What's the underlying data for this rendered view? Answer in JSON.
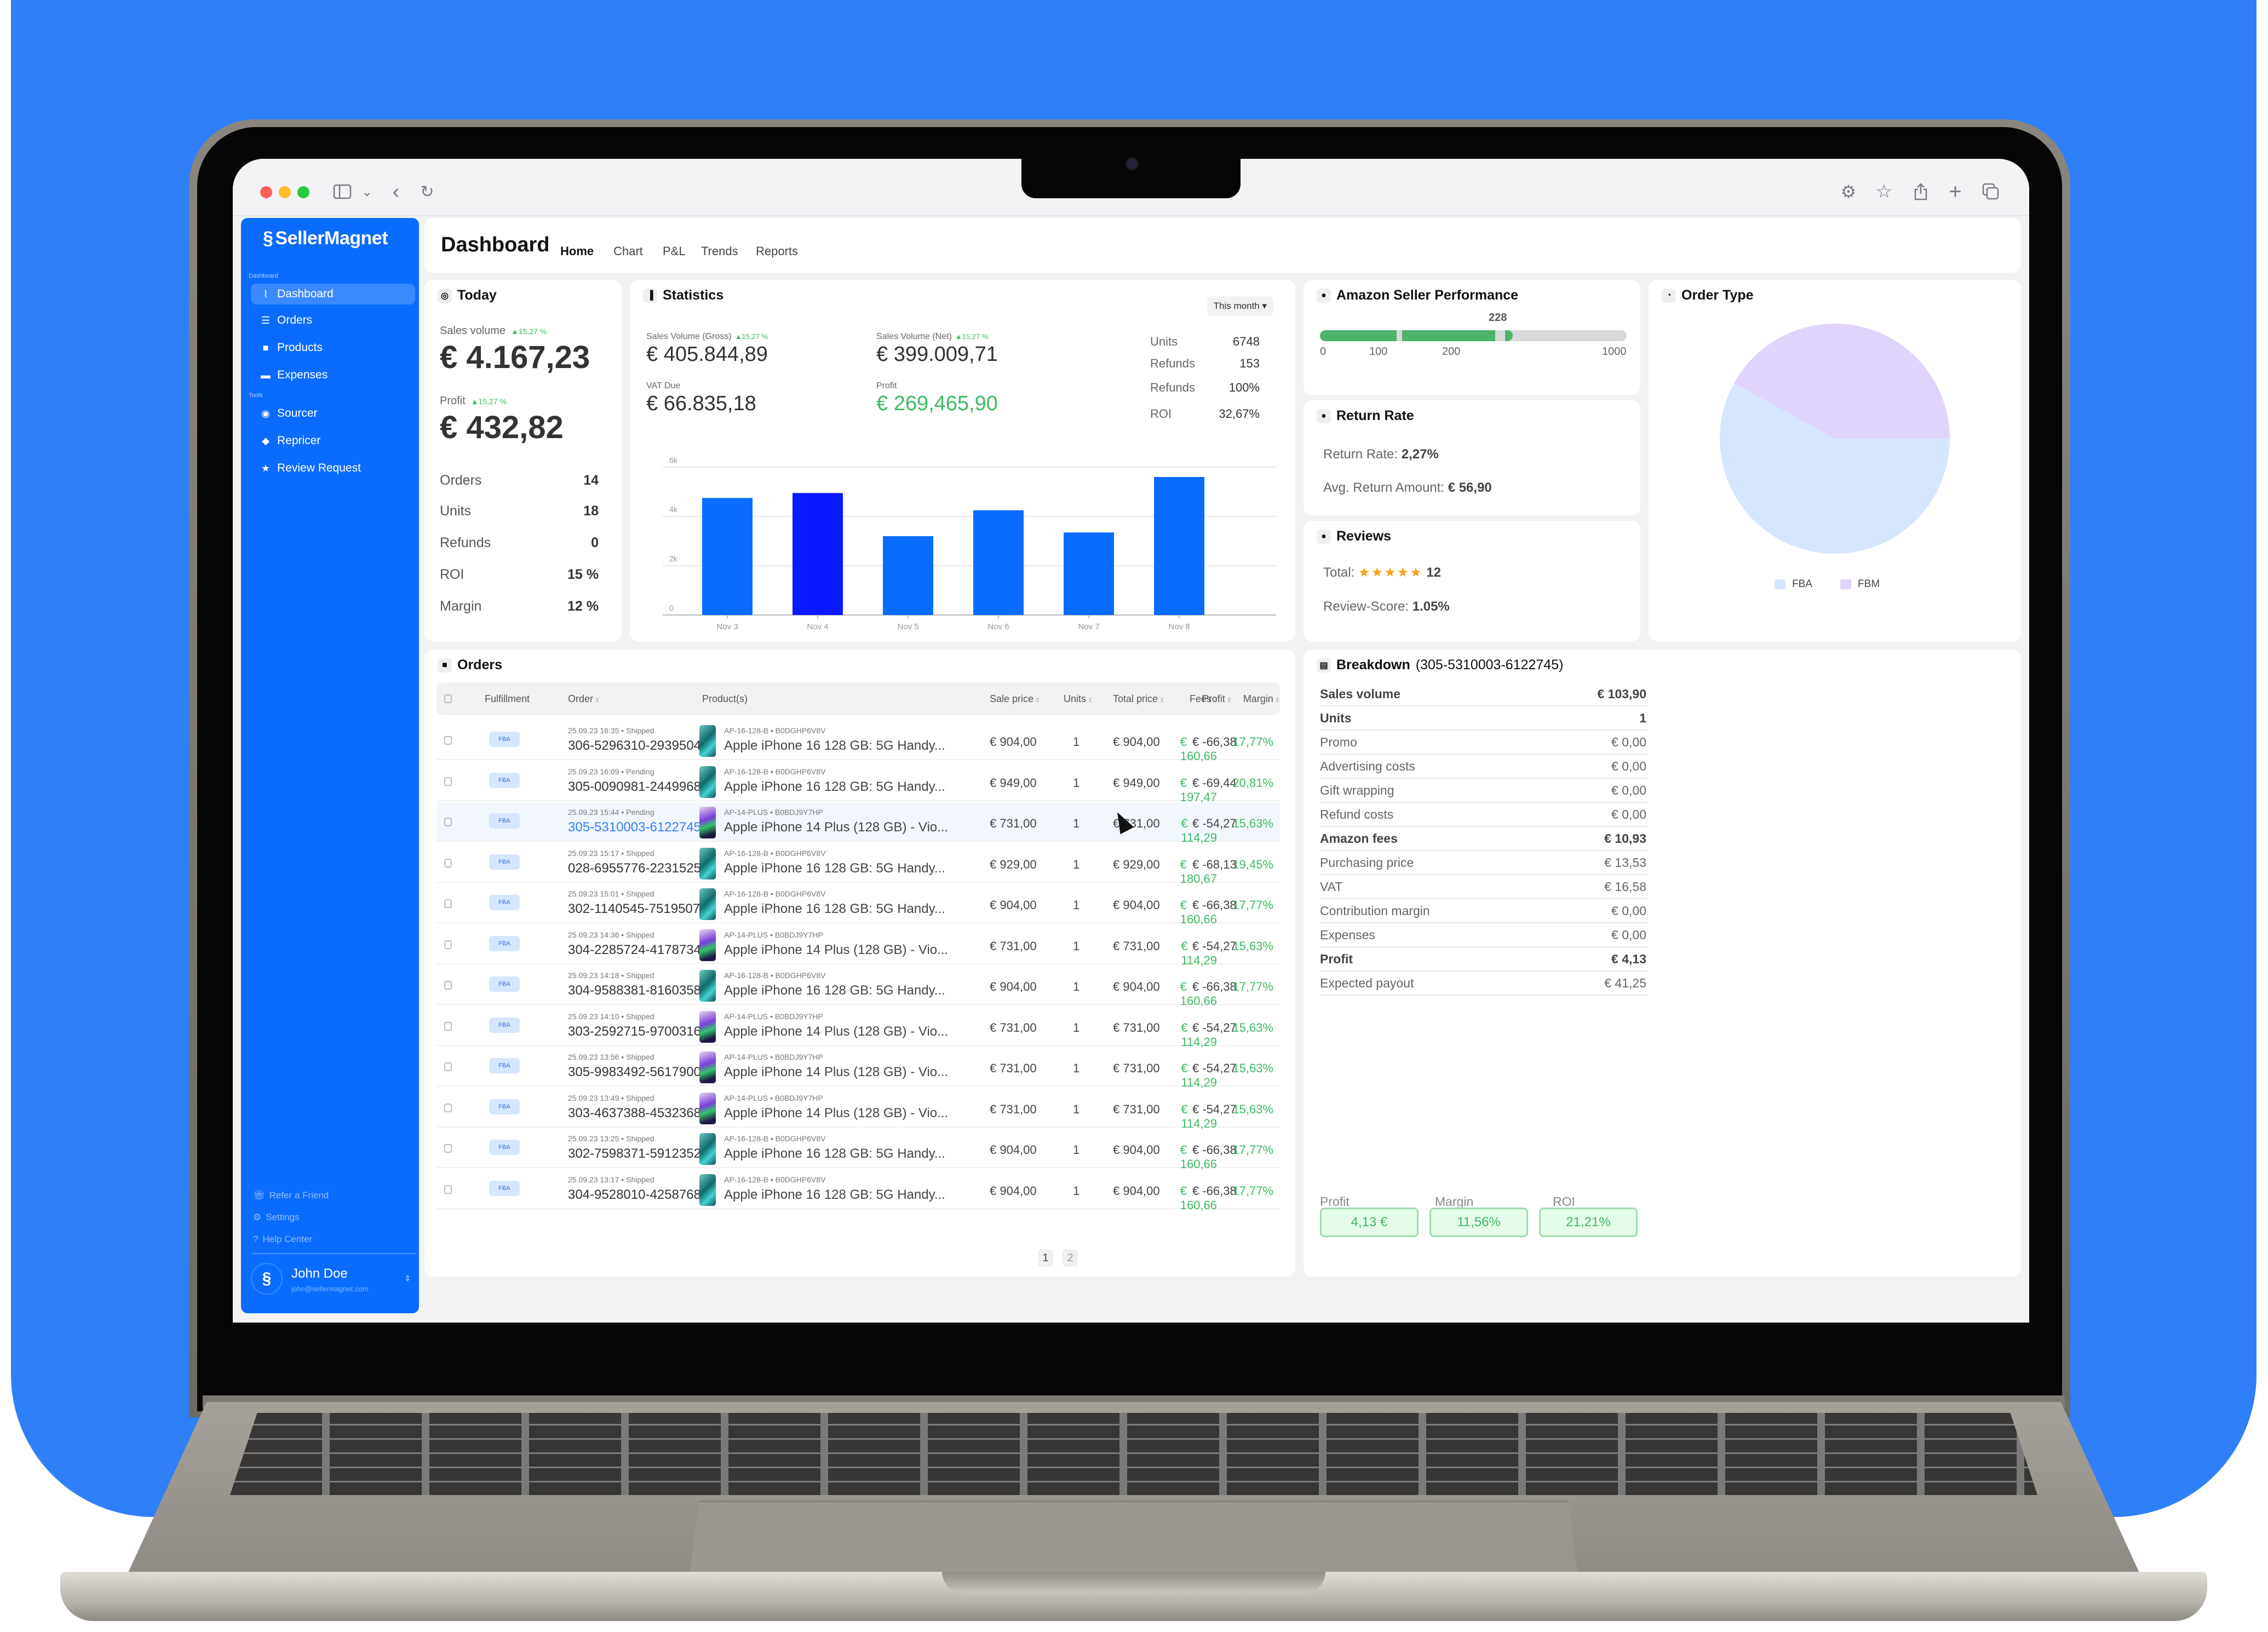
{
  "browser": {
    "toolbar_icons_left": [
      "sidebar-toggle-icon",
      "chevron-down-icon",
      "back-icon",
      "reload-icon"
    ],
    "toolbar_icons_right": [
      "gear-icon",
      "star-icon",
      "share-icon",
      "plus-icon",
      "tabs-icon"
    ]
  },
  "sidebar": {
    "logo": "SellerMagnet",
    "section_dashboard": "Dashboard",
    "section_tools": "Tools",
    "items": [
      {
        "label": "Dashboard",
        "icon": "chart-line-icon",
        "active": true
      },
      {
        "label": "Orders",
        "icon": "list-icon"
      },
      {
        "label": "Products",
        "icon": "box-icon"
      },
      {
        "label": "Expenses",
        "icon": "credit-card-icon"
      },
      {
        "label": "Sourcer",
        "icon": "radar-icon"
      },
      {
        "label": "Repricer",
        "icon": "tag-icon"
      },
      {
        "label": "Review Request",
        "icon": "star-icon"
      }
    ],
    "footer": [
      {
        "label": "Refer a Friend",
        "icon": "gift-icon"
      },
      {
        "label": "Settings",
        "icon": "gear-icon"
      },
      {
        "label": "Help Center",
        "icon": "help-icon"
      }
    ],
    "user": {
      "name": "John Doe",
      "email": "john@sellermagnet.com"
    }
  },
  "header": {
    "title": "Dashboard",
    "tabs": [
      "Home",
      "Chart",
      "P&L",
      "Trends",
      "Reports"
    ],
    "active_tab": "Home"
  },
  "today": {
    "title": "Today",
    "sales_label": "Sales volume",
    "sales_change": "▲15,27 %",
    "sales_value": "€ 4.167,23",
    "profit_label": "Profit",
    "profit_change": "▲15,27 %",
    "profit_value": "€ 432,82",
    "rows": [
      {
        "label": "Orders",
        "value": "14"
      },
      {
        "label": "Units",
        "value": "18"
      },
      {
        "label": "Refunds",
        "value": "0"
      },
      {
        "label": "ROI",
        "value": "15 %"
      },
      {
        "label": "Margin",
        "value": "12 %"
      }
    ]
  },
  "statistics": {
    "title": "Statistics",
    "period": "This month ▾",
    "gross_label": "Sales Volume (Gross)",
    "gross_change": "▲15,27 %",
    "gross_value": "€ 405.844,89",
    "net_label": "Sales Volume (Net)",
    "net_change": "▲15,27 %",
    "net_value": "€ 399.009,71",
    "vat_label": "VAT Due",
    "vat_value": "€ 66.835,18",
    "profit_label": "Profit",
    "profit_value": "€ 269,465,90",
    "side": [
      {
        "label": "Units",
        "value": "6748"
      },
      {
        "label": "Refunds",
        "value": "153"
      },
      {
        "label": "Refunds",
        "value": "100%"
      },
      {
        "label": "ROI",
        "value": "32,67%"
      }
    ]
  },
  "seller_performance": {
    "title": "Amazon Seller Performance",
    "value": 228,
    "value_label": "228",
    "max": 1000,
    "ticks": [
      "0",
      "100",
      "200",
      "1000"
    ],
    "color": "#4db36a"
  },
  "return_rate": {
    "title": "Return Rate",
    "rate_label": "Return Rate:",
    "rate_value": "2,27%",
    "avg_label": "Avg. Return Amount:",
    "avg_value": "€ 56,90"
  },
  "reviews": {
    "title": "Reviews",
    "total_label": "Total:",
    "stars": "★★★★★",
    "total_value": "12",
    "score_label": "Review-Score:",
    "score_value": "1.05%"
  },
  "order_type": {
    "title": "Order Type"
  },
  "orders": {
    "title": "Orders",
    "columns": [
      "Fulfillment",
      "Order",
      "Product(s)",
      "Sale price",
      "Units",
      "Total price",
      "Fees",
      "Profit",
      "Margin"
    ],
    "rows": [
      {
        "fulfillment": "FBA",
        "meta": "25.09.23 16:35 • Shipped",
        "order": "306-5296310-2939504",
        "sku": "AP-16-128-B • B0DGHP6V8V",
        "product": "Apple iPhone 16 128 GB: 5G Handy...",
        "thumb": "g",
        "sale": "€ 904,00",
        "units": "1",
        "total": "€ 904,00",
        "fees": "€ -66,38",
        "profit": "€ 160,66",
        "margin": "17,77%"
      },
      {
        "fulfillment": "FBA",
        "meta": "25.09.23 16:09 • Pending",
        "order": "305-0090981-2449968",
        "sku": "AP-16-128-B • B0DGHP6V8V",
        "product": "Apple iPhone 16 128 GB: 5G Handy...",
        "thumb": "g",
        "sale": "€ 949,00",
        "units": "1",
        "total": "€ 949,00",
        "fees": "€ -69,44",
        "profit": "€ 197,47",
        "margin": "20,81%"
      },
      {
        "fulfillment": "FBA",
        "meta": "25.09.23 15:44 • Pending",
        "order": "305-5310003-6122745",
        "sku": "AP-14-PLUS • B0BDJ9Y7HP",
        "product": "Apple iPhone 14 Plus (128 GB) - Vio...",
        "thumb": "p",
        "sale": "€ 731,00",
        "units": "1",
        "total": "€ 731,00",
        "fees": "€ -54,27",
        "profit": "€ 114,29",
        "margin": "15,63%",
        "selected": true
      },
      {
        "fulfillment": "FBA",
        "meta": "25.09.23 15:17 • Shipped",
        "order": "028-6955776-2231525",
        "sku": "AP-16-128-B • B0DGHP6V8V",
        "product": "Apple iPhone 16 128 GB: 5G Handy...",
        "thumb": "g",
        "sale": "€ 929,00",
        "units": "1",
        "total": "€ 929,00",
        "fees": "€ -68,13",
        "profit": "€ 180,67",
        "margin": "19,45%"
      },
      {
        "fulfillment": "FBA",
        "meta": "25.09.23 15:01 • Shipped",
        "order": "302-1140545-7519507",
        "sku": "AP-16-128-B • B0DGHP6V8V",
        "product": "Apple iPhone 16 128 GB: 5G Handy...",
        "thumb": "g",
        "sale": "€ 904,00",
        "units": "1",
        "total": "€ 904,00",
        "fees": "€ -66,38",
        "profit": "€ 160,66",
        "margin": "17,77%"
      },
      {
        "fulfillment": "FBA",
        "meta": "25.09.23 14:36 • Shipped",
        "order": "304-2285724-4178734",
        "sku": "AP-14-PLUS • B0BDJ9Y7HP",
        "product": "Apple iPhone 14 Plus (128 GB) - Vio...",
        "thumb": "p",
        "sale": "€ 731,00",
        "units": "1",
        "total": "€ 731,00",
        "fees": "€ -54,27",
        "profit": "€ 114,29",
        "margin": "15,63%"
      },
      {
        "fulfillment": "FBA",
        "meta": "25.09.23 14:18 • Shipped",
        "order": "304-9588381-8160358",
        "sku": "AP-16-128-B • B0DGHP6V8V",
        "product": "Apple iPhone 16 128 GB: 5G Handy...",
        "thumb": "g",
        "sale": "€ 904,00",
        "units": "1",
        "total": "€ 904,00",
        "fees": "€ -66,38",
        "profit": "€ 160,66",
        "margin": "17,77%"
      },
      {
        "fulfillment": "FBA",
        "meta": "25.09.23 14:10 • Shipped",
        "order": "303-2592715-9700316",
        "sku": "AP-14-PLUS • B0BDJ9Y7HP",
        "product": "Apple iPhone 14 Plus (128 GB) - Vio...",
        "thumb": "p",
        "sale": "€ 731,00",
        "units": "1",
        "total": "€ 731,00",
        "fees": "€ -54,27",
        "profit": "€ 114,29",
        "margin": "15,63%"
      },
      {
        "fulfillment": "FBA",
        "meta": "25.09.23 13:56 • Shipped",
        "order": "305-9983492-5617900",
        "sku": "AP-14-PLUS • B0BDJ9Y7HP",
        "product": "Apple iPhone 14 Plus (128 GB) - Vio...",
        "thumb": "p",
        "sale": "€ 731,00",
        "units": "1",
        "total": "€ 731,00",
        "fees": "€ -54,27",
        "profit": "€ 114,29",
        "margin": "15,63%"
      },
      {
        "fulfillment": "FBA",
        "meta": "25.09.23 13:49 • Shipped",
        "order": "303-4637388-4532368",
        "sku": "AP-14-PLUS • B0BDJ9Y7HP",
        "product": "Apple iPhone 14 Plus (128 GB) - Vio...",
        "thumb": "p",
        "sale": "€ 731,00",
        "units": "1",
        "total": "€ 731,00",
        "fees": "€ -54,27",
        "profit": "€ 114,29",
        "margin": "15,63%"
      },
      {
        "fulfillment": "FBA",
        "meta": "25.09.23 13:25 • Shipped",
        "order": "302-7598371-5912352",
        "sku": "AP-16-128-B • B0DGHP6V8V",
        "product": "Apple iPhone 16 128 GB: 5G Handy...",
        "thumb": "g",
        "sale": "€ 904,00",
        "units": "1",
        "total": "€ 904,00",
        "fees": "€ -66,38",
        "profit": "€ 160,66",
        "margin": "17,77%"
      },
      {
        "fulfillment": "FBA",
        "meta": "25.09.23 13:17 • Shipped",
        "order": "304-9528010-4258768",
        "sku": "AP-16-128-B • B0DGHP6V8V",
        "product": "Apple iPhone 16 128 GB: 5G Handy...",
        "thumb": "g",
        "sale": "€ 904,00",
        "units": "1",
        "total": "€ 904,00",
        "fees": "€ -66,38",
        "profit": "€ 160,66",
        "margin": "17,77%"
      }
    ],
    "pages": [
      "1",
      "2"
    ],
    "current_page": "1"
  },
  "breakdown": {
    "title": "Breakdown",
    "order_id": "(305-5310003-6122745)",
    "rows": [
      {
        "label": "Sales volume",
        "value": "€ 103,90",
        "bold": true
      },
      {
        "label": "Units",
        "value": "1",
        "bold": true
      },
      {
        "label": "Promo",
        "value": "€ 0,00"
      },
      {
        "label": "Advertising costs",
        "value": "€ 0,00"
      },
      {
        "label": "Gift wrapping",
        "value": "€ 0,00"
      },
      {
        "label": "Refund costs",
        "value": "€ 0,00"
      },
      {
        "label": "Amazon fees",
        "value": "€ 10,93",
        "bold": true
      },
      {
        "label": "Purchasing price",
        "value": "€ 13,53"
      },
      {
        "label": "VAT",
        "value": "€ 16,58"
      },
      {
        "label": "Contribution margin",
        "value": "€ 0,00"
      },
      {
        "label": "Expenses",
        "value": "€ 0,00"
      },
      {
        "label": "Profit",
        "value": "€ 4,13",
        "bold": true
      },
      {
        "label": "Expected payout",
        "value": "€ 41,25"
      }
    ],
    "kpis": [
      {
        "label": "Profit",
        "value": "4,13 €"
      },
      {
        "label": "Margin",
        "value": "11,56%"
      },
      {
        "label": "ROI",
        "value": "21,21%"
      }
    ]
  },
  "colors": {
    "brand": "#0a6cff",
    "bar": "#0a6cff",
    "bar_highlight": "#0a19ff",
    "positive": "#3dbb61",
    "fba": "#d6e6ff",
    "fbm": "#e0d4fc"
  },
  "chart_data": [
    {
      "type": "bar",
      "title": "Statistics",
      "categories": [
        "Nov 3",
        "Nov 4",
        "Nov 5",
        "Nov 6",
        "Nov 7",
        "Nov 8"
      ],
      "values": [
        4750,
        4950,
        3200,
        4250,
        3350,
        5600
      ],
      "highlighted": "Nov 4",
      "yticks": [
        "0",
        "2k",
        "4k",
        "6k"
      ],
      "ylim": [
        0,
        6000
      ],
      "xlabel": "",
      "ylabel": "",
      "grid": true
    },
    {
      "type": "pie",
      "title": "Order Type",
      "labels": [
        "FBA",
        "FBM"
      ],
      "values": [
        58,
        42
      ],
      "legend": "bottom"
    }
  ]
}
